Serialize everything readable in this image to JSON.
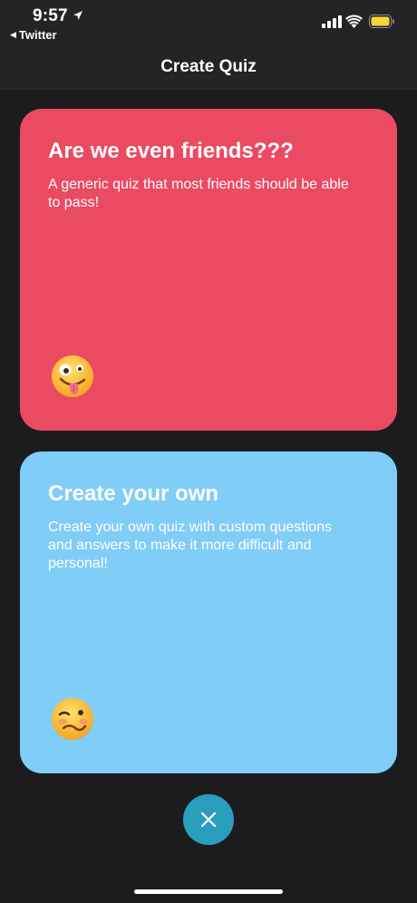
{
  "status_bar": {
    "time": "9:57",
    "back_app": "Twitter",
    "battery_color": "#f4d63a"
  },
  "nav": {
    "title": "Create Quiz"
  },
  "cards": [
    {
      "title": "Are we even friends???",
      "description": "A generic quiz that most friends should be able to pass!",
      "color": "#eb4a63",
      "emoji": "zany-face"
    },
    {
      "title": "Create your own",
      "description": "Create your own quiz with custom questions and answers to make it more difficult and personal!",
      "color": "#80cdf8",
      "emoji": "woozy-face"
    }
  ],
  "close_button": {
    "icon": "close-icon",
    "color": "#2a9ebd"
  }
}
